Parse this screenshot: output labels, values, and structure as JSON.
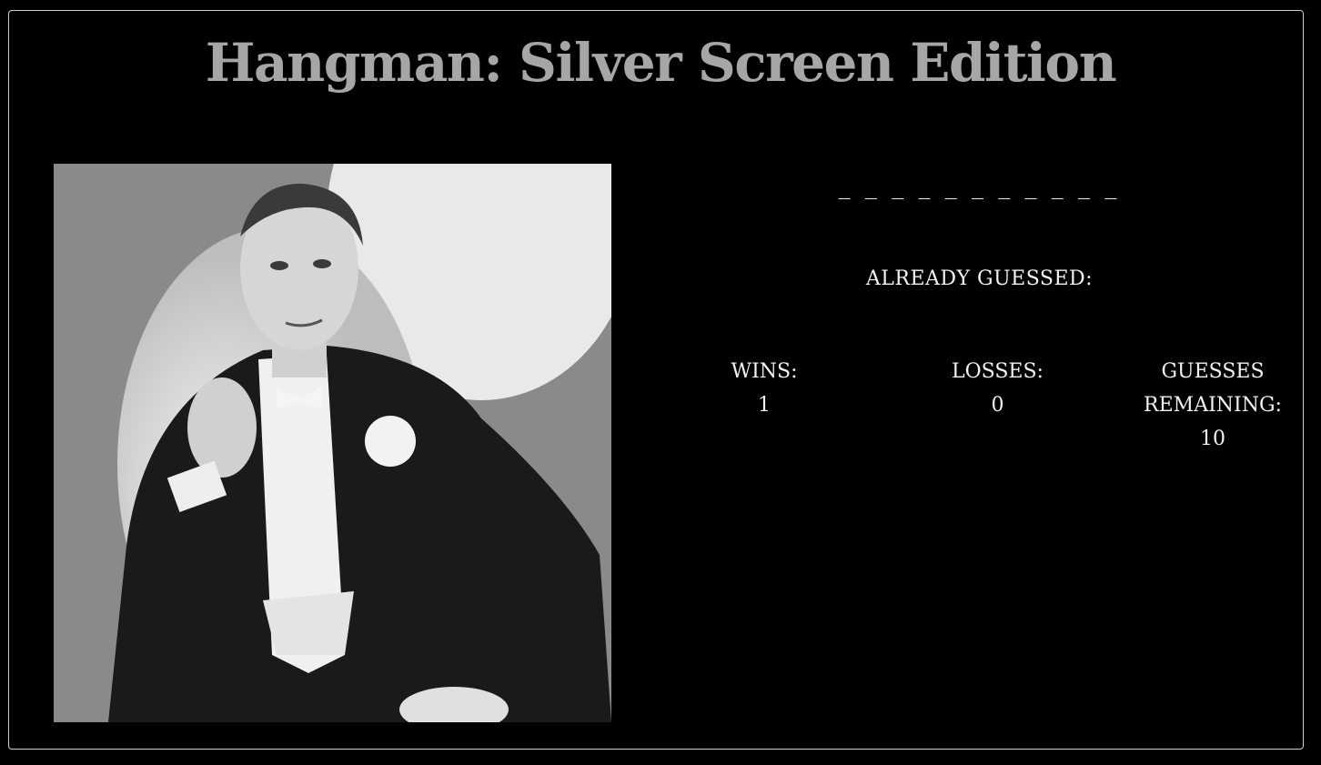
{
  "game": {
    "title": "Hangman: Silver Screen Edition",
    "word_display": "_ _ _ _ _ _ _   _ _ _ _",
    "already_guessed_label": "ALREADY GUESSED:"
  },
  "stats": {
    "wins_label": "WINS:",
    "wins_value": "1",
    "losses_label": "LOSSES:",
    "losses_value": "0",
    "remaining_label": "GUESSES REMAINING:",
    "remaining_value": "10"
  },
  "colors": {
    "background": "#000000",
    "title": "#a6a6a6",
    "text": "#f2f2f2",
    "border": "#cfcfcf"
  }
}
